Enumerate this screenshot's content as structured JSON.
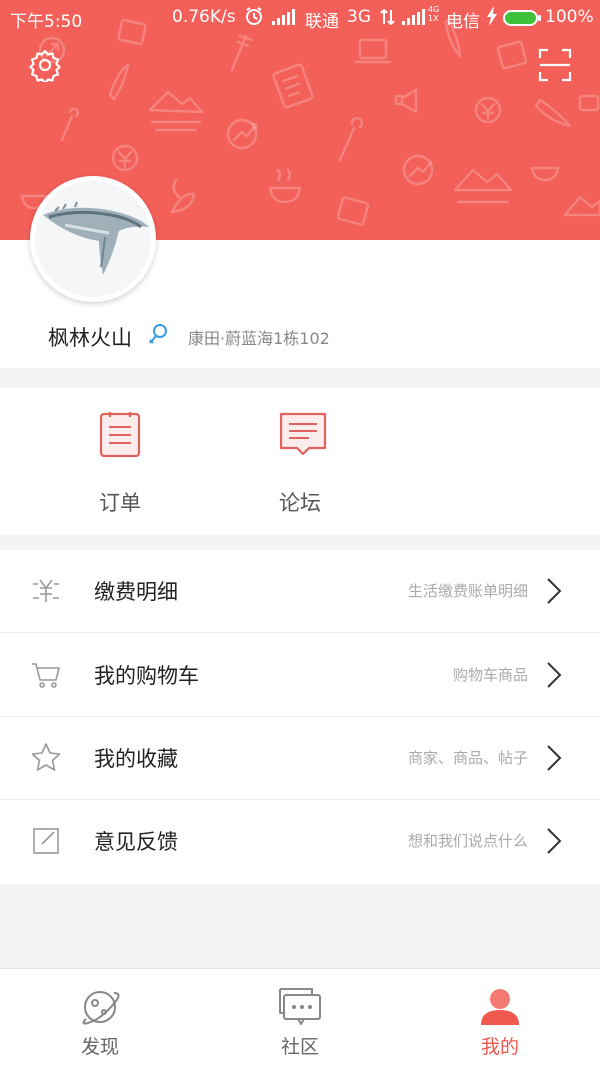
{
  "status_bar": {
    "time": "下午5:50",
    "speed": "0.76K/s",
    "carrier1": "联通",
    "network": "3G",
    "network2_tag": "4G\n1X",
    "carrier2": "电信",
    "battery": "100%",
    "icons": [
      "alarm-icon",
      "signal-icon",
      "data-arrows-icon",
      "signal-icon",
      "charging-icon",
      "battery-icon"
    ]
  },
  "header": {
    "background_color": "#f3605a",
    "settings_icon": "gear-icon",
    "scan_icon": "scan-icon"
  },
  "profile": {
    "username": "枫林火山",
    "verify_icon": "verified-icon",
    "address": "康田·蔚蓝海1栋102"
  },
  "quick_actions": [
    {
      "label": "订单",
      "icon": "order-icon"
    },
    {
      "label": "论坛",
      "icon": "forum-icon"
    }
  ],
  "menu": [
    {
      "label": "缴费明细",
      "hint": "生活缴费账单明细",
      "icon": "yuan-bill-icon"
    },
    {
      "label": "我的购物车",
      "hint": "购物车商品",
      "icon": "cart-icon"
    },
    {
      "label": "我的收藏",
      "hint": "商家、商品、帖子",
      "icon": "star-icon"
    },
    {
      "label": "意见反馈",
      "hint": "想和我们说点什么",
      "icon": "feedback-icon"
    }
  ],
  "bottom_nav": [
    {
      "label": "发现",
      "icon": "planet-icon",
      "active": false
    },
    {
      "label": "社区",
      "icon": "chat-bubble-icon",
      "active": false
    },
    {
      "label": "我的",
      "icon": "user-icon",
      "active": true
    }
  ],
  "accent_color": "#f0584e"
}
